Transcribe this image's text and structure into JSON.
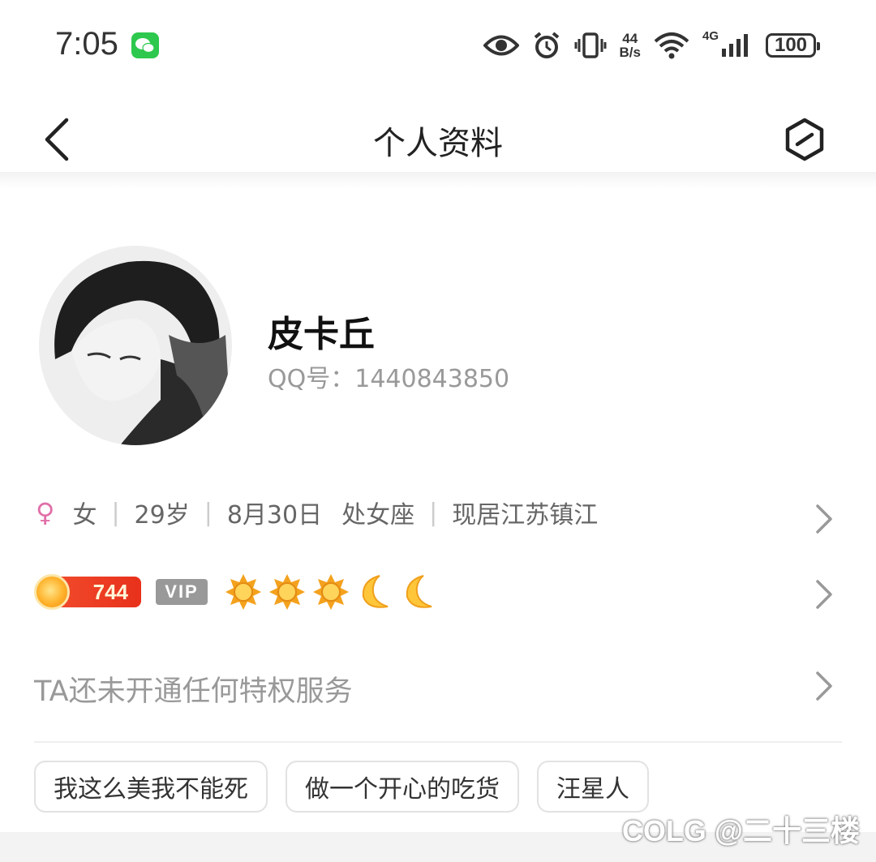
{
  "status_bar": {
    "time": "7:05",
    "network_speed_value": "44",
    "network_speed_unit": "B/s",
    "network_type": "4G",
    "battery": "100",
    "icons": [
      "wechat-icon",
      "eye-icon",
      "alarm-icon",
      "vibrate-icon",
      "wifi-icon",
      "signal-icon",
      "battery-icon"
    ]
  },
  "header": {
    "title": "个人资料"
  },
  "profile": {
    "name": "皮卡丘",
    "qq_label": "QQ号：1440843850"
  },
  "info": {
    "gender_symbol": "♀",
    "gender": "女",
    "age": "29岁",
    "birthday": "8月30日",
    "zodiac": "处女座",
    "location": "现居江苏镇江"
  },
  "level": {
    "points": "744",
    "vip_label": "VIP",
    "icons": [
      "sun",
      "sun",
      "sun",
      "moon",
      "moon"
    ]
  },
  "privilege_text": "TA还未开通任何特权服务",
  "tags": [
    "我这么美我不能死",
    "做一个开心的吃货",
    "汪星人"
  ],
  "watermark": "COLG @二十三楼",
  "colors": {
    "female_pink": "#e06fa8",
    "level_red": "#e8311b",
    "text_gray": "#999999"
  }
}
